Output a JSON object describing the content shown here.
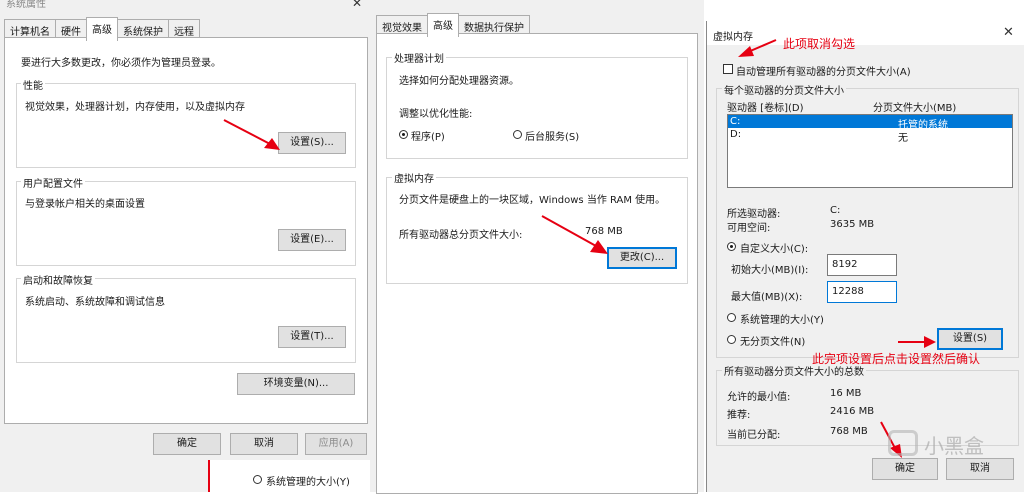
{
  "left": {
    "title": "系统属性",
    "tabs": [
      "计算机名",
      "硬件",
      "高级",
      "系统保护",
      "远程"
    ],
    "notice": "要进行大多数更改，你必须作为管理员登录。",
    "performance": {
      "label": "性能",
      "desc": "视觉效果，处理器计划，内存使用，以及虚拟内存",
      "button": "设置(S)..."
    },
    "profile": {
      "label": "用户配置文件",
      "desc": "与登录帐户相关的桌面设置",
      "button": "设置(E)..."
    },
    "startup": {
      "label": "启动和故障恢复",
      "desc": "系统启动、系统故障和调试信息",
      "button": "设置(T)..."
    },
    "env_button": "环境变量(N)...",
    "ok": "确定",
    "cancel": "取消",
    "apply": "应用(A)",
    "peek_radio": "系统管理的大小(Y)"
  },
  "middle": {
    "tabs": [
      "视觉效果",
      "高级",
      "数据执行保护"
    ],
    "processor": {
      "label": "处理器计划",
      "desc": "选择如何分配处理器资源。",
      "adjust": "调整以优化性能:",
      "opt_programs": "程序(P)",
      "opt_services": "后台服务(S)"
    },
    "vm": {
      "label": "虚拟内存",
      "desc": "分页文件是硬盘上的一块区域，Windows 当作 RAM 使用。",
      "total_label": "所有驱动器总分页文件大小:",
      "total_value": "768 MB",
      "button": "更改(C)..."
    }
  },
  "right": {
    "title": "虚拟内存",
    "annot_top": "此项取消勾选",
    "auto_manage": "自动管理所有驱动器的分页文件大小(A)",
    "per_drive_label": "每个驱动器的分页文件大小",
    "col_drive": "驱动器 [卷标](D)",
    "col_size": "分页文件大小(MB)",
    "drives": [
      {
        "drive": "C:",
        "size": "托管的系统"
      },
      {
        "drive": "D:",
        "size": "无"
      }
    ],
    "selected_drive_label": "所选驱动器:",
    "selected_drive_value": "C:",
    "free_label": "可用空间:",
    "free_value": "3635 MB",
    "custom_size": "自定义大小(C):",
    "initial_label": "初始大小(MB)(I):",
    "initial_value": "8192",
    "max_label": "最大值(MB)(X):",
    "max_value": "12288",
    "system_managed": "系统管理的大小(Y)",
    "no_paging": "无分页文件(N)",
    "set_button": "设置(S)",
    "annot_bottom": "此完项设置后点击设置然后确认",
    "total_label": "所有驱动器分页文件大小的总数",
    "min_label": "允许的最小值:",
    "min_value": "16 MB",
    "rec_label": "推荐:",
    "rec_value": "2416 MB",
    "cur_label": "当前已分配:",
    "cur_value": "768 MB",
    "ok": "确定",
    "cancel": "取消",
    "watermark": "小黑盒"
  },
  "colors": {
    "annotation": "#e60012",
    "accent": "#0078d7",
    "dialog_bg": "#f0f0f0"
  }
}
